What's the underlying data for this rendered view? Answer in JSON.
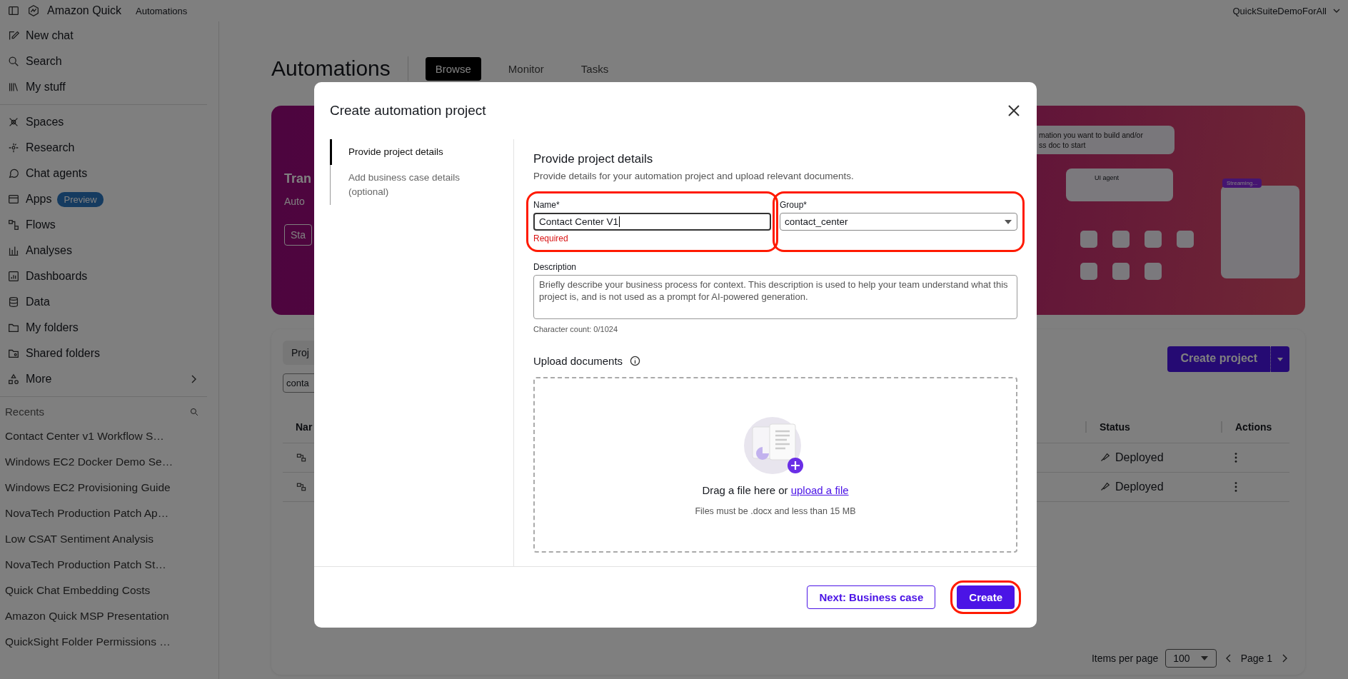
{
  "topbar": {
    "app_name": "Amazon Quick",
    "section": "Automations",
    "account": "QuickSuiteDemoForAll"
  },
  "sidebar": {
    "nav_top": [
      {
        "label": "New chat",
        "kind": "edit"
      },
      {
        "label": "Search",
        "kind": "search"
      },
      {
        "label": "My stuff",
        "kind": "library"
      }
    ],
    "nav_main": [
      {
        "label": "Spaces",
        "kind": "spaces"
      },
      {
        "label": "Research",
        "kind": "research"
      },
      {
        "label": "Chat agents",
        "kind": "agents"
      },
      {
        "label": "Apps",
        "kind": "apps",
        "badge": "Preview"
      },
      {
        "label": "Flows",
        "kind": "flows"
      },
      {
        "label": "Analyses",
        "kind": "analyses"
      },
      {
        "label": "Dashboards",
        "kind": "dashboards"
      },
      {
        "label": "Data",
        "kind": "data"
      },
      {
        "label": "My folders",
        "kind": "folder"
      },
      {
        "label": "Shared folders",
        "kind": "shared"
      },
      {
        "label": "More",
        "kind": "more",
        "expandable": true
      }
    ],
    "recents_title": "Recents",
    "recents": [
      "Contact Center v1 Workflow S…",
      "Windows EC2 Docker Demo Se…",
      "Windows EC2 Provisioning Guide",
      "NovaTech Production Patch Ap…",
      "Low CSAT Sentiment Analysis",
      "NovaTech Production Patch St…",
      "Quick Chat Embedding Costs",
      "Amazon Quick MSP Presentation",
      "QuickSight Folder Permissions …"
    ]
  },
  "page": {
    "title": "Automations",
    "tabs": [
      {
        "label": "Browse",
        "selected": true
      },
      {
        "label": "Monitor",
        "selected": false
      },
      {
        "label": "Tasks",
        "selected": false
      }
    ]
  },
  "banner": {
    "heading": "Tran",
    "subheading": "Auto",
    "button": "Sta",
    "callout": [
      "mation you want to build and/or",
      "ss doc to start"
    ],
    "agent_card": "UI agent",
    "stream_label": "Streaming..."
  },
  "projects": {
    "filter_tab": "Proj",
    "search_value": "conta",
    "create_button": "Create project",
    "columns": [
      "Nar",
      "Status",
      "Actions"
    ],
    "rows": [
      {
        "status": "Deployed"
      },
      {
        "status": "Deployed"
      }
    ],
    "items_per_page_label": "Items per page",
    "items_per_page": "100",
    "page": "Page 1"
  },
  "modal": {
    "title": "Create automation project",
    "steps": [
      {
        "label": "Provide project details",
        "selected": true
      },
      {
        "label": "Add business case details (optional)",
        "selected": false
      }
    ],
    "heading": "Provide project details",
    "subheading": "Provide details for your automation project and upload relevant documents.",
    "name_field": {
      "label": "Name*",
      "value": "Contact Center V1",
      "error": "Required",
      "highlighted": true
    },
    "group_field": {
      "label": "Group*",
      "value": "contact_center",
      "highlighted": true
    },
    "description": {
      "label": "Description",
      "placeholder": "Briefly describe your business process for context. This description is used to help your team understand what this project is, and is not used as a prompt for AI-powered generation.",
      "counter": "Character count: 0/1024"
    },
    "upload": {
      "title": "Upload documents",
      "prompt": "Drag a file here or",
      "link": "upload a file",
      "hint": "Files must be .docx and less than 15 MB"
    },
    "buttons": [
      {
        "label": "Next: Business case",
        "kind": "secondary",
        "highlighted": false
      },
      {
        "label": "Create",
        "kind": "primary",
        "highlighted": true
      }
    ]
  }
}
